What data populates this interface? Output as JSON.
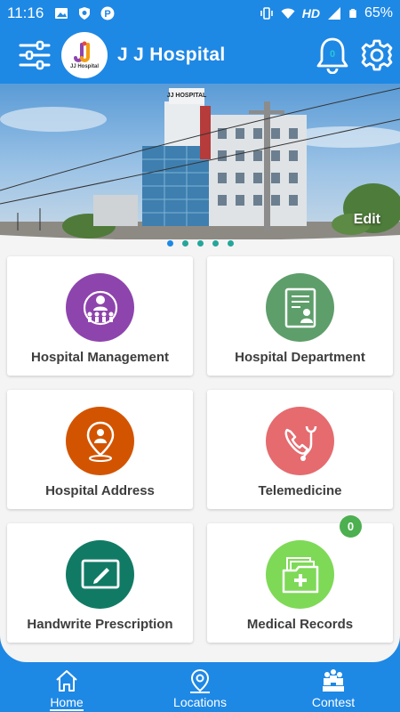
{
  "status_bar": {
    "time": "11:16",
    "network": "HD",
    "battery": "65%"
  },
  "header": {
    "title": "J J Hospital",
    "logo_text": "JJ Hospital",
    "notification_count": "0"
  },
  "banner": {
    "building_sign": "JJ HOSPITAL",
    "edit_label": "Edit",
    "slide_count": 5,
    "active_slide": 1
  },
  "tiles": [
    {
      "label": "Hospital Management",
      "icon": "people-management-icon",
      "color": "#8e44ad"
    },
    {
      "label": "Hospital Department",
      "icon": "department-id-icon",
      "color": "#5e9e6a"
    },
    {
      "label": "Hospital Address",
      "icon": "location-pin-icon",
      "color": "#d35400"
    },
    {
      "label": "Telemedicine",
      "icon": "phone-stethoscope-icon",
      "color": "#e56b6f"
    },
    {
      "label": "Handwrite Prescription",
      "icon": "tablet-pen-icon",
      "color": "#117a65"
    },
    {
      "label": "Medical Records",
      "icon": "medical-folder-icon",
      "color": "#7ed957",
      "badge": "0"
    }
  ],
  "bottom_nav": [
    {
      "label": "Home",
      "icon": "home-icon",
      "active": true
    },
    {
      "label": "Locations",
      "icon": "map-pin-icon",
      "active": false
    },
    {
      "label": "Contest",
      "icon": "podium-icon",
      "active": false
    }
  ],
  "colors": {
    "primary": "#1e88e5",
    "background": "#f4f4f4",
    "badge": "#4caf50"
  }
}
